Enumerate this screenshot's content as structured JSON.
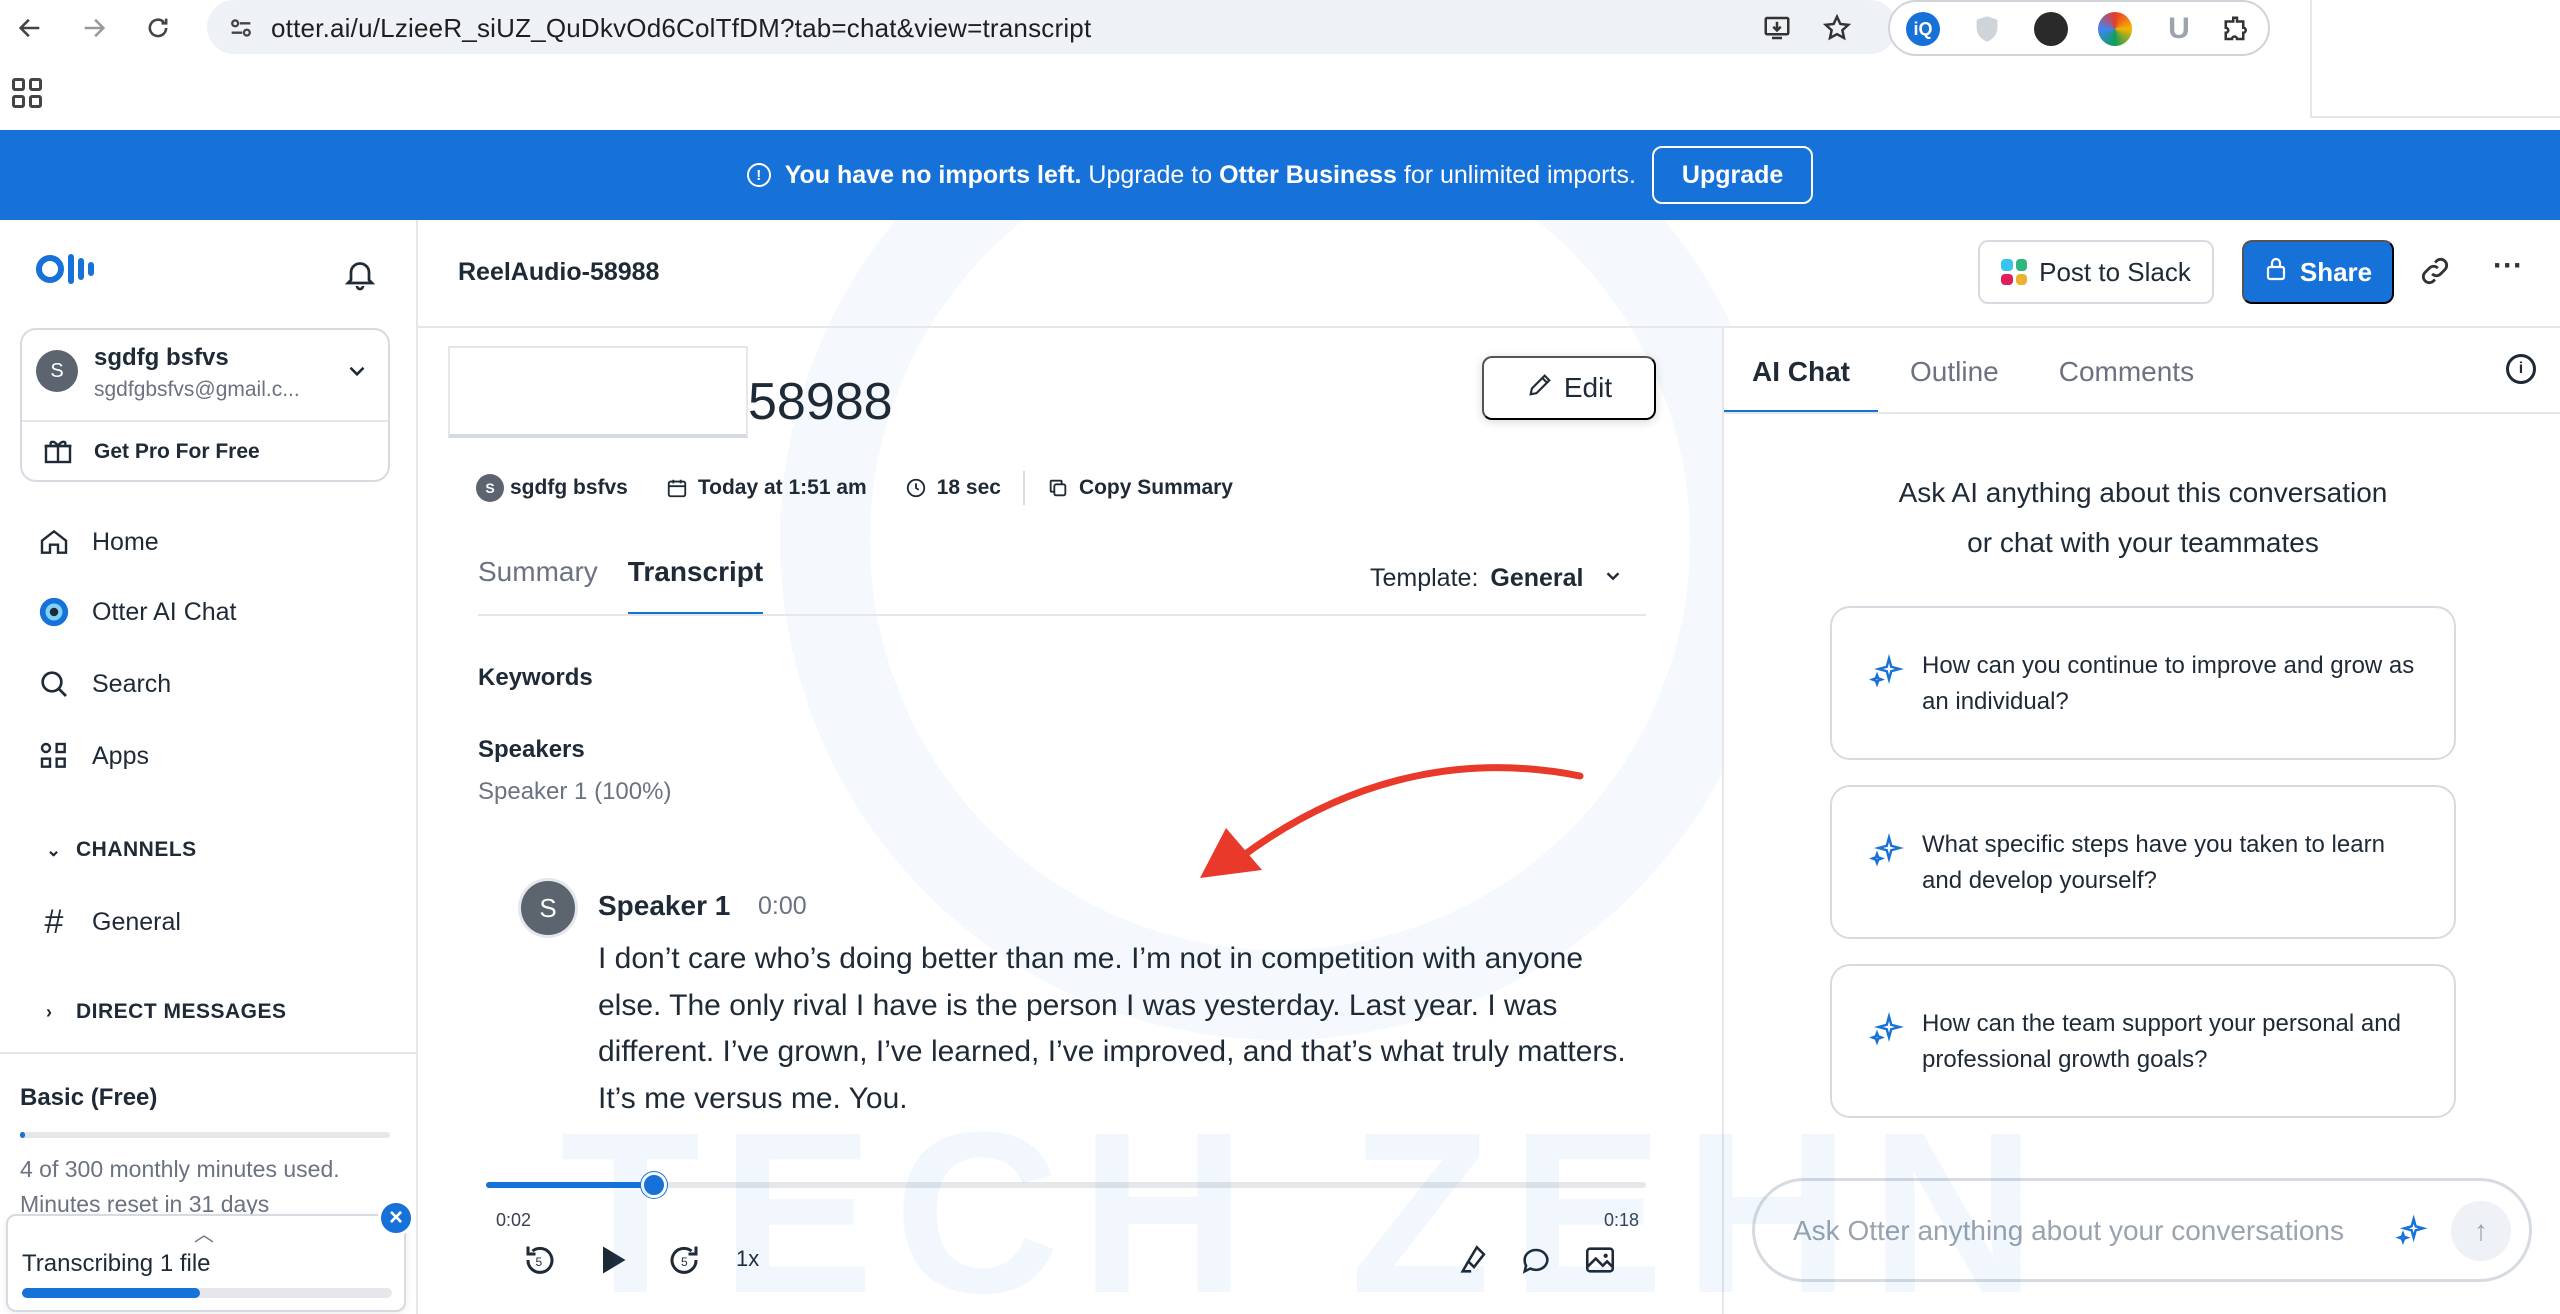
{
  "browser": {
    "url": "otter.ai/u/LzieeR_siUZ_QuDkvOd6ColTfDM?tab=chat&view=transcript"
  },
  "banner": {
    "bold_text": "You have no imports left.",
    "text_a": " Upgrade to ",
    "bold_brand": "Otter Business",
    "text_b": " for unlimited imports.",
    "button": "Upgrade"
  },
  "sidebar": {
    "user": {
      "initial": "S",
      "name": "sgdfg bsfvs",
      "email": "sgdfgbsfvs@gmail.c..."
    },
    "get_pro": "Get Pro For Free",
    "nav": [
      {
        "label": "Home",
        "icon": "home-icon"
      },
      {
        "label": "Otter AI Chat",
        "icon": "otter-ai-chat-icon"
      },
      {
        "label": "Search",
        "icon": "search-icon"
      },
      {
        "label": "Apps",
        "icon": "apps-icon"
      }
    ],
    "channels_header": "CHANNELS",
    "channel_general": "General",
    "dm_header": "DIRECT MESSAGES",
    "plan": {
      "title": "Basic (Free)",
      "usage": "4 of 300 monthly minutes used.",
      "reset": "Minutes reset in 31 days",
      "usage_fraction": 0.013
    },
    "transcribing": {
      "label": "Transcribing 1 file",
      "progress": 0.48
    }
  },
  "header": {
    "title": "ReelAudio-58988",
    "slack_button": "Post to Slack",
    "share_button": "Share"
  },
  "main": {
    "title_visible": "58988",
    "edit_button": "Edit",
    "meta": {
      "owner_initial": "S",
      "owner": "sgdfg bsfvs",
      "date": "Today at 1:51 am",
      "duration": "18 sec",
      "copy": "Copy Summary"
    },
    "tabs": [
      "Summary",
      "Transcript"
    ],
    "template_label": "Template:",
    "template_value": "General",
    "keywords_heading": "Keywords",
    "speakers_heading": "Speakers",
    "speakers_value": "Speaker 1 (100%)",
    "transcript": {
      "initial": "S",
      "speaker": "Speaker 1",
      "time": "0:00",
      "text": "I don’t care who’s doing better than me. I’m not in competition with anyone else. The only rival I have is the person I was yesterday. Last year. I was different. I’ve grown, I’ve learned, I’ve improved, and that’s what truly matters. It’s me versus me. You."
    }
  },
  "player": {
    "current": "0:02",
    "total": "0:18",
    "speed": "1x",
    "progress": 0.145
  },
  "right_panel": {
    "tabs": [
      "AI Chat",
      "Outline",
      "Comments"
    ],
    "heading_line1": "Ask AI anything about this conversation",
    "heading_line2": "or chat with your teammates",
    "suggestions": [
      "How can you continue to improve and grow as an individual?",
      "What specific steps have you taken to learn and develop yourself?",
      "How can the team support your personal and professional growth goals?"
    ],
    "input_placeholder": "Ask Otter anything about your conversations"
  },
  "watermark": "TECH ZEHN",
  "colors": {
    "brand": "#1671d8",
    "annotation_arrow": "#e8392a"
  }
}
